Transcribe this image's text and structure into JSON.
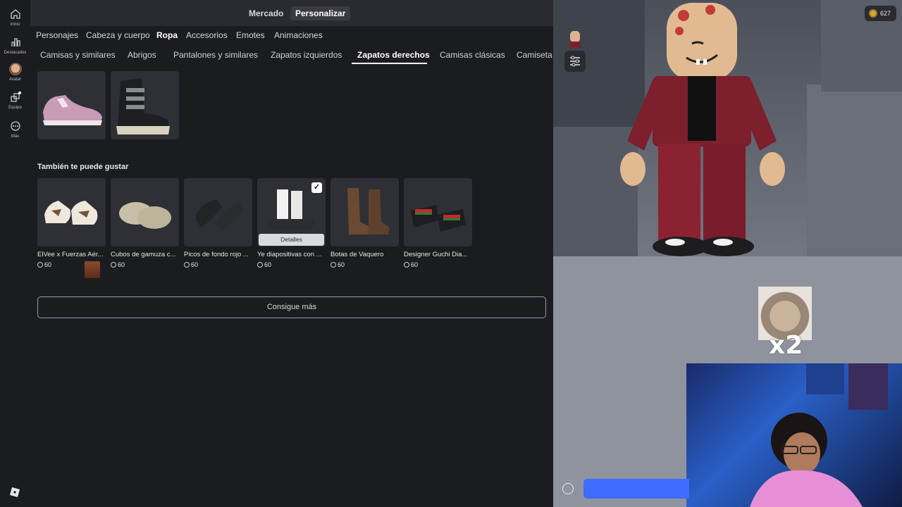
{
  "rail": {
    "items": [
      {
        "label": "Inicio",
        "icon": "home-icon"
      },
      {
        "label": "Destacados",
        "icon": "chart-icon"
      },
      {
        "label": "Avatar",
        "icon": "avatar-icon"
      },
      {
        "label": "Equipo",
        "icon": "team-icon"
      },
      {
        "label": "Más",
        "icon": "more-icon"
      }
    ]
  },
  "topbar": {
    "tabs": [
      "Mercado",
      "Personalizar"
    ],
    "active": "Personalizar"
  },
  "categories": [
    "Personajes",
    "Cabeza y cuerpo",
    "Ropa",
    "Accesorios",
    "Emotes",
    "Animaciones"
  ],
  "subcategories": [
    "Camisas y similares",
    "Abrigos",
    "Pantalones y similares",
    "Zapatos izquierdos",
    "Zapatos derechos",
    "Camisas clásicas",
    "Camiseta"
  ],
  "owned_items": [
    {
      "name": "pink sneaker"
    },
    {
      "name": "black boot"
    }
  ],
  "recommend": {
    "title": "También te puede gustar",
    "items": [
      {
        "name": "ElVee x Fuerzas Aér...",
        "price": "60"
      },
      {
        "name": "Cubos de gamuza c...",
        "price": "60"
      },
      {
        "name": "Picos de fondo rojo ...",
        "price": "60"
      },
      {
        "name": "Ye diapositivas con ...",
        "price": "60",
        "button": "Detalles"
      },
      {
        "name": "Botas de Vaquero",
        "price": "60"
      },
      {
        "name": "Designer Guchi Dia...",
        "price": "60"
      }
    ]
  },
  "more_button": "Consigue más",
  "robux": "627",
  "overlay": {
    "sticker_text": "x2"
  },
  "colors": {
    "accent": "#3d6cff",
    "panel": "#1b1c20",
    "topbar": "#2a2b30"
  }
}
